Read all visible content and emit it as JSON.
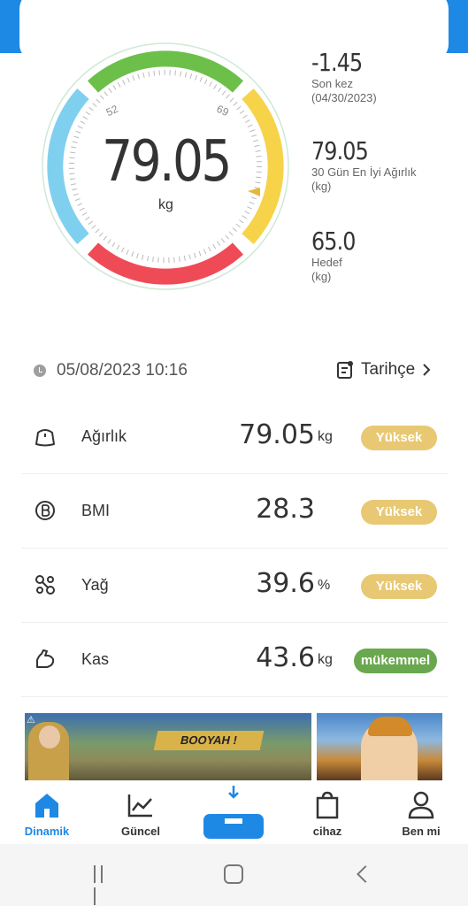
{
  "gauge": {
    "value": "79.05",
    "unit": "kg",
    "tick_left": "52",
    "tick_right": "69",
    "colors": {
      "green": "#6cc04a",
      "yellow": "#f7d34a",
      "red": "#ef4b57",
      "blue": "#7fd0ef"
    }
  },
  "stats": [
    {
      "value": "-1.45",
      "label_line1": "Son kez",
      "label_line2": "(04/30/2023)"
    },
    {
      "value": "79.05",
      "label_line1": "30 Gün En İyi Ağırlık",
      "label_line2": "(kg)"
    },
    {
      "value": "65.0",
      "label_line1": "Hedef",
      "label_line2": "(kg)"
    }
  ],
  "datetime": "05/08/2023 10:16",
  "history_label": "Tarihçe",
  "metrics": [
    {
      "name": "Ağırlık",
      "value": "79.05",
      "unit": "kg",
      "badge": "Yüksek",
      "badge_color": "#e8c872",
      "icon": "weight-icon"
    },
    {
      "name": "BMI",
      "value": "28.3",
      "unit": "",
      "badge": "Yüksek",
      "badge_color": "#e8c872",
      "icon": "bmi-icon"
    },
    {
      "name": "Yağ",
      "value": "39.6",
      "unit": "%",
      "badge": "Yüksek",
      "badge_color": "#e8c872",
      "icon": "fat-icon"
    },
    {
      "name": "Kas",
      "value": "43.6",
      "unit": "kg",
      "badge": "mükemmel",
      "badge_color": "#6aa84f",
      "icon": "muscle-icon"
    }
  ],
  "ad": {
    "banner_text": "BOOYAH !"
  },
  "nav": [
    {
      "label": "Dinamik",
      "icon": "home-icon",
      "active": true
    },
    {
      "label": "Güncel",
      "icon": "chart-icon",
      "active": false
    },
    {
      "label": "",
      "icon": "scale-icon",
      "active": false
    },
    {
      "label": "cihaz",
      "icon": "bag-icon",
      "active": false
    },
    {
      "label": "Ben mi",
      "icon": "person-icon",
      "active": false
    }
  ],
  "brand_color": "#1e88e5"
}
